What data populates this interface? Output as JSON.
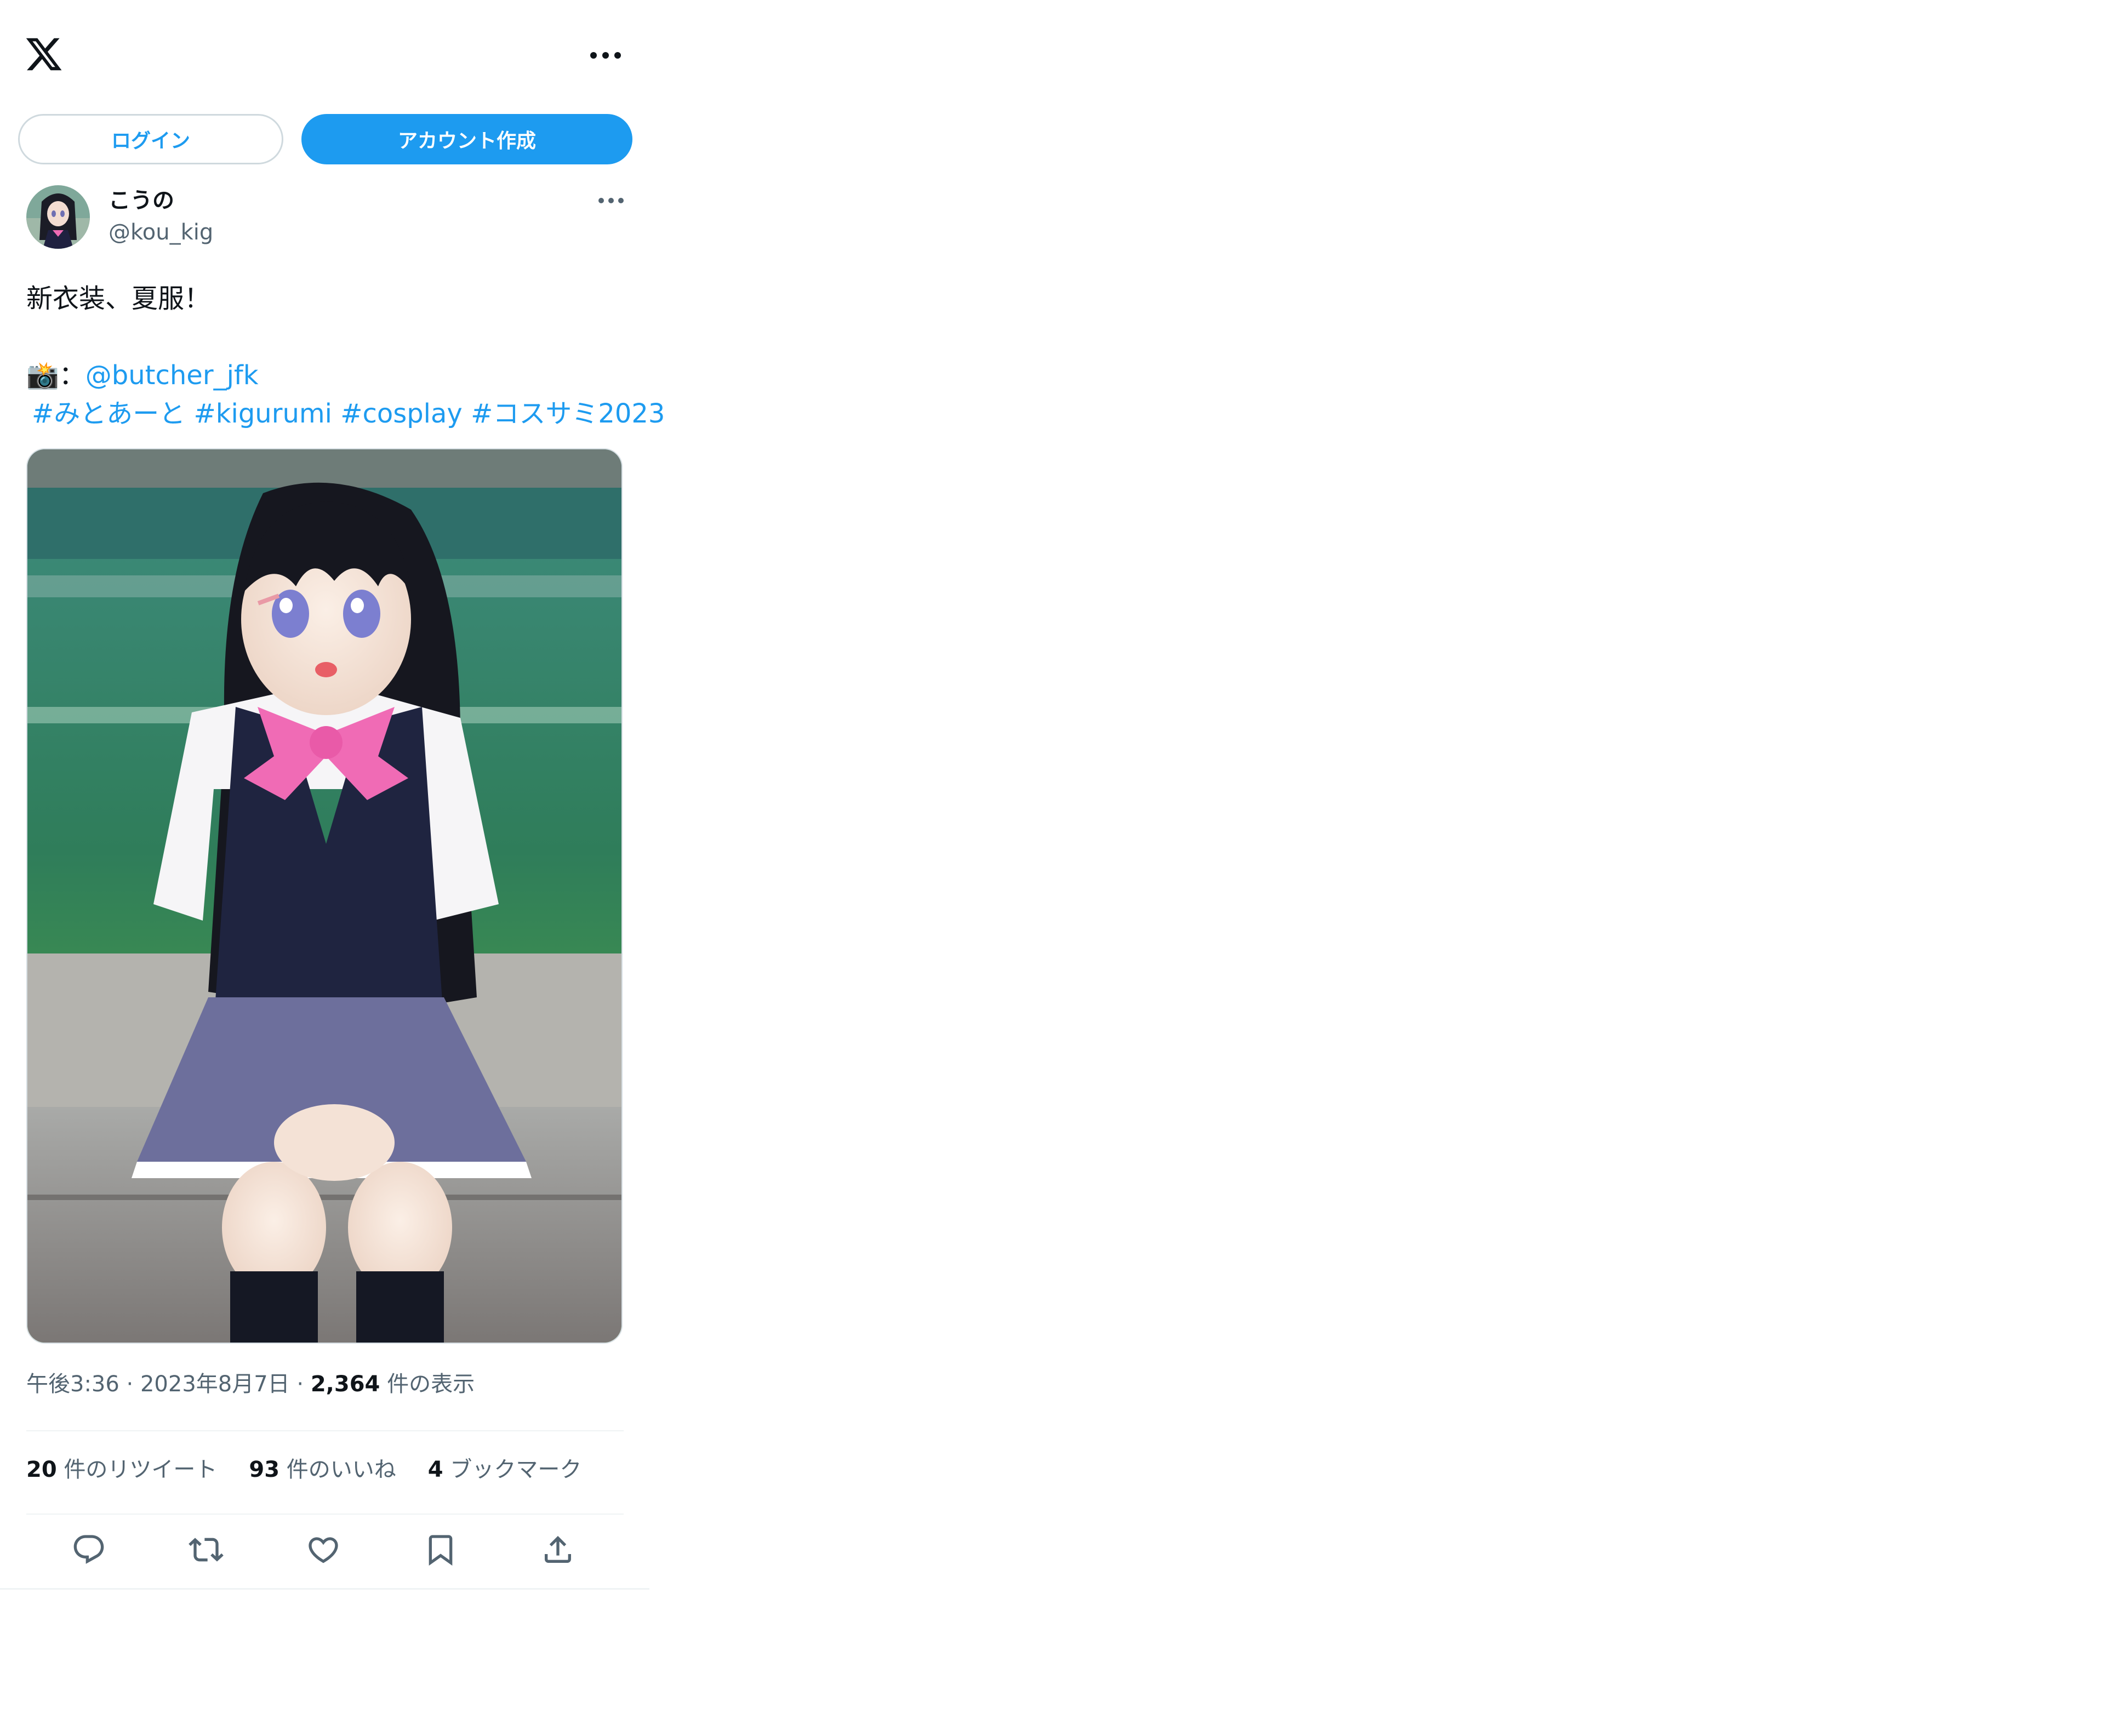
{
  "header": {
    "logo_icon": "x-logo-icon",
    "more_icon": "more-horizontal-icon"
  },
  "auth": {
    "login_label": "ログイン",
    "signup_label": "アカウント作成"
  },
  "tweet": {
    "author": {
      "display_name": "こうの",
      "handle": "@kou_kig"
    },
    "text_line1": "新衣装、夏服！",
    "camera_emoji": "📸",
    "colon": "：",
    "mention": "@butcher_jfk",
    "hashtags": "#みとあーと #kigurumi #cosplay #コスサミ2023",
    "time": "午後3:36",
    "date": "2023年8月7日",
    "views_count": "2,364",
    "views_label": "件の表示",
    "retweets_count": "20",
    "retweets_label": "件のリツイート",
    "likes_count": "93",
    "likes_label": "件のいいね",
    "bookmarks_count": "4",
    "bookmarks_label": "ブックマーク"
  },
  "colors": {
    "accent": "#1d9bf0",
    "text_primary": "#0f1419",
    "text_secondary": "#536471",
    "border": "#cfd9de"
  }
}
